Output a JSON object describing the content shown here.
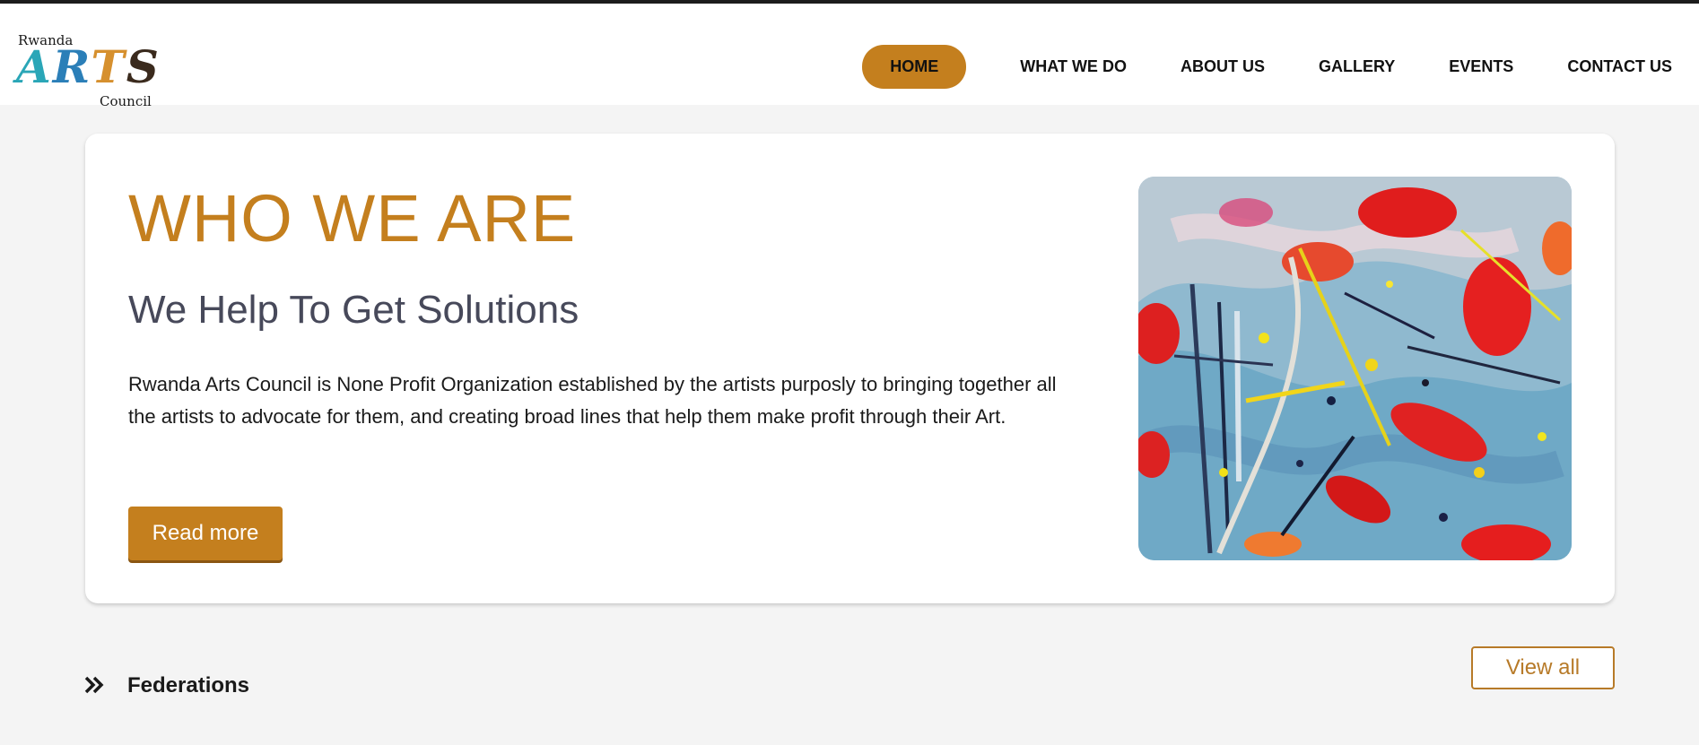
{
  "logo": {
    "line1": "Rwanda",
    "arts_letters": [
      "A",
      "R",
      "T",
      "S"
    ],
    "line3": "Council",
    "colors": [
      "#2aa6b7",
      "#2b7fb8",
      "#d6902e",
      "#3a2a1d"
    ]
  },
  "nav": {
    "items": [
      {
        "label": "HOME",
        "active": true
      },
      {
        "label": "WHAT WE DO",
        "active": false
      },
      {
        "label": "ABOUT US",
        "active": false
      },
      {
        "label": "GALLERY",
        "active": false
      },
      {
        "label": "EVENTS",
        "active": false
      },
      {
        "label": "CONTACT US",
        "active": false
      }
    ]
  },
  "hero": {
    "title": "WHO WE ARE",
    "subtitle": "We Help To Get Solutions",
    "body": "Rwanda Arts Council is None Profit Organization established by the artists purposly to bringing together all the artists to advocate for them, and creating broad lines that help them make profit through their Art.",
    "button_label": "Read more",
    "image_icon": "abstract-painting-image"
  },
  "federations": {
    "icon": "double-chevron-right-icon",
    "title": "Federations",
    "view_all_label": "View all"
  },
  "colors": {
    "accent": "#c47f1e",
    "subtitle": "#47495a",
    "background": "#f4f4f4"
  }
}
